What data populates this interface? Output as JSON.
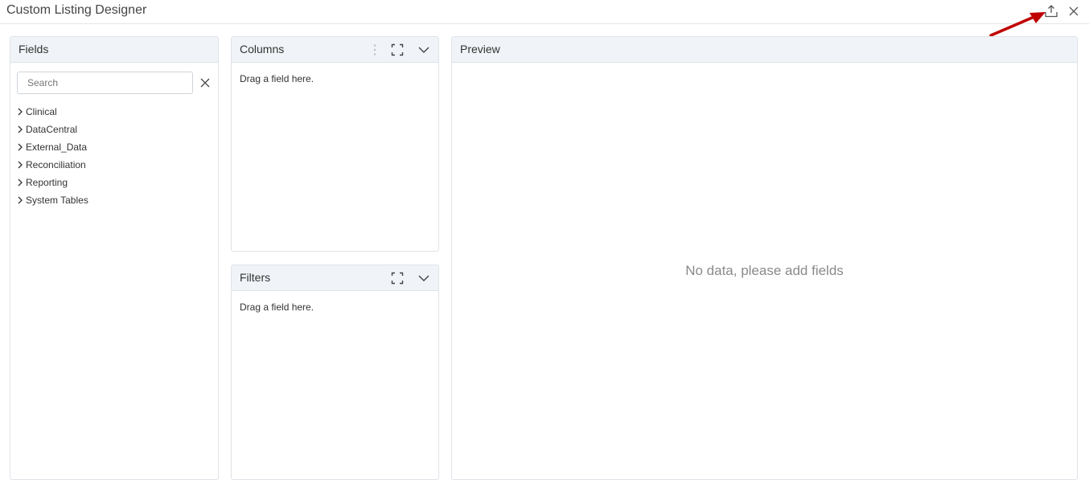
{
  "window": {
    "title": "Custom Listing Designer",
    "actions": [
      {
        "icon": "export-icon"
      },
      {
        "icon": "close-icon"
      }
    ]
  },
  "annotation": {
    "color": "#c00000"
  },
  "fields": {
    "title": "Fields",
    "search": {
      "placeholder": "Search",
      "value": ""
    },
    "items": [
      {
        "label": "Clinical"
      },
      {
        "label": "DataCentral"
      },
      {
        "label": "External_Data"
      },
      {
        "label": "Reconciliation"
      },
      {
        "label": "Reporting"
      },
      {
        "label": "System Tables"
      }
    ]
  },
  "columns": {
    "title": "Columns",
    "hint": "Drag a field here."
  },
  "filters": {
    "title": "Filters",
    "hint": "Drag a field here."
  },
  "preview": {
    "title": "Preview",
    "empty_message": "No data, please add fields"
  },
  "colors": {
    "header_bg": "#f0f3f7",
    "border": "#dfe3e8",
    "muted_text": "#8a8a8a"
  }
}
